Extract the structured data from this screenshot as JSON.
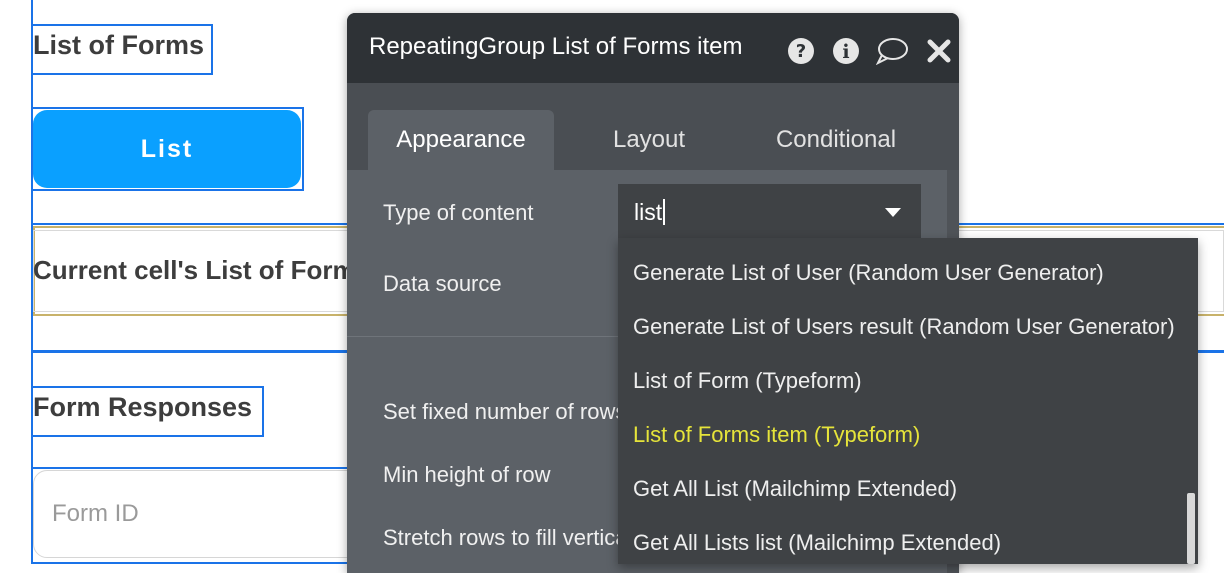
{
  "canvas": {
    "heading": "List of Forms",
    "list_button": "List",
    "current_cell_text": "Current cell's List of Forms",
    "form_responses": "Form Responses",
    "form_id_placeholder": "Form ID"
  },
  "panel": {
    "title": "RepeatingGroup List of Forms item",
    "header_icons": [
      "help-icon",
      "info-icon",
      "comment-icon",
      "close-icon"
    ],
    "tabs": [
      {
        "label": "Appearance",
        "active": true
      },
      {
        "label": "Layout",
        "active": false
      },
      {
        "label": "Conditional",
        "active": false
      }
    ],
    "properties": {
      "type_of_content": "Type of content",
      "data_source": "Data source",
      "set_fixed_rows": "Set fixed number of rows",
      "min_height": "Min height of row",
      "stretch_rows": "Stretch rows to fill vertical space"
    }
  },
  "dropdown": {
    "value": "list",
    "options": [
      "Generate List of User (Random User Generator)",
      "Generate List of Users result (Random User Generator)",
      "List of Form (Typeform)",
      "List of Forms item (Typeform)",
      "Get All List (Mailchimp Extended)",
      "Get All Lists list (Mailchimp Extended)"
    ],
    "highlighted_index": 3
  },
  "colors": {
    "accent_blue": "#1a73e8",
    "button_blue": "#0aa0ff",
    "panel_bg": "#5c6167",
    "highlight_yellow": "#e6e43a"
  }
}
